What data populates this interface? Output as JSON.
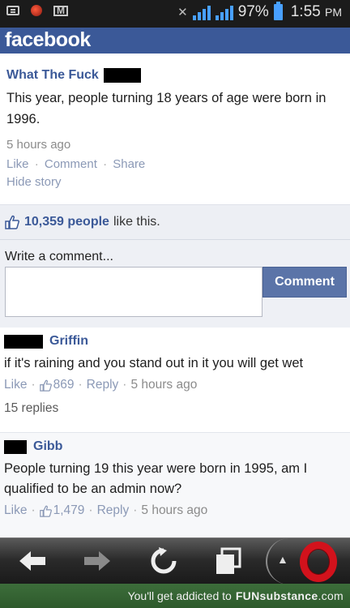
{
  "status_bar": {
    "battery": "97%",
    "time": "1:55",
    "ampm": "PM"
  },
  "app": {
    "logo": "facebook"
  },
  "story": {
    "poster_name": "What The Fuck",
    "text": "This year, people turning 18 years of age were born in 1996.",
    "timestamp": "5 hours ago",
    "like_label": "Like",
    "comment_label": "Comment",
    "share_label": "Share",
    "separator": "·",
    "hide_label": "Hide story"
  },
  "likes": {
    "count": "10,359 people",
    "suffix": "like this."
  },
  "write_comment": {
    "label": "Write a comment...",
    "input_value": "",
    "button_label": "Comment"
  },
  "comments": [
    {
      "name": "Griffin",
      "text": "if it's raining and you stand out in it you will get wet",
      "like_label": "Like",
      "like_count": "869",
      "reply_label": "Reply",
      "timestamp": "5 hours ago",
      "replies_label": "15 replies"
    },
    {
      "name": "Gibb",
      "text": "People turning 19 this year were born in 1995, am I qualified to be an admin now?",
      "like_label": "Like",
      "like_count": "1,479",
      "reply_label": "Reply",
      "timestamp": "5 hours ago"
    }
  ],
  "footer": {
    "text": "You'll get addicted to",
    "brand": "FUNsubstance",
    "domain": ".com"
  },
  "icons": {
    "back": "back-arrow-icon",
    "forward": "forward-arrow-icon",
    "reload": "reload-icon",
    "tabs": "tabs-icon",
    "menu": "opera-menu-icon"
  },
  "colors": {
    "facebook_blue": "#3b5998",
    "comment_button": "#5b74a8",
    "opera_red": "#d2121c"
  }
}
